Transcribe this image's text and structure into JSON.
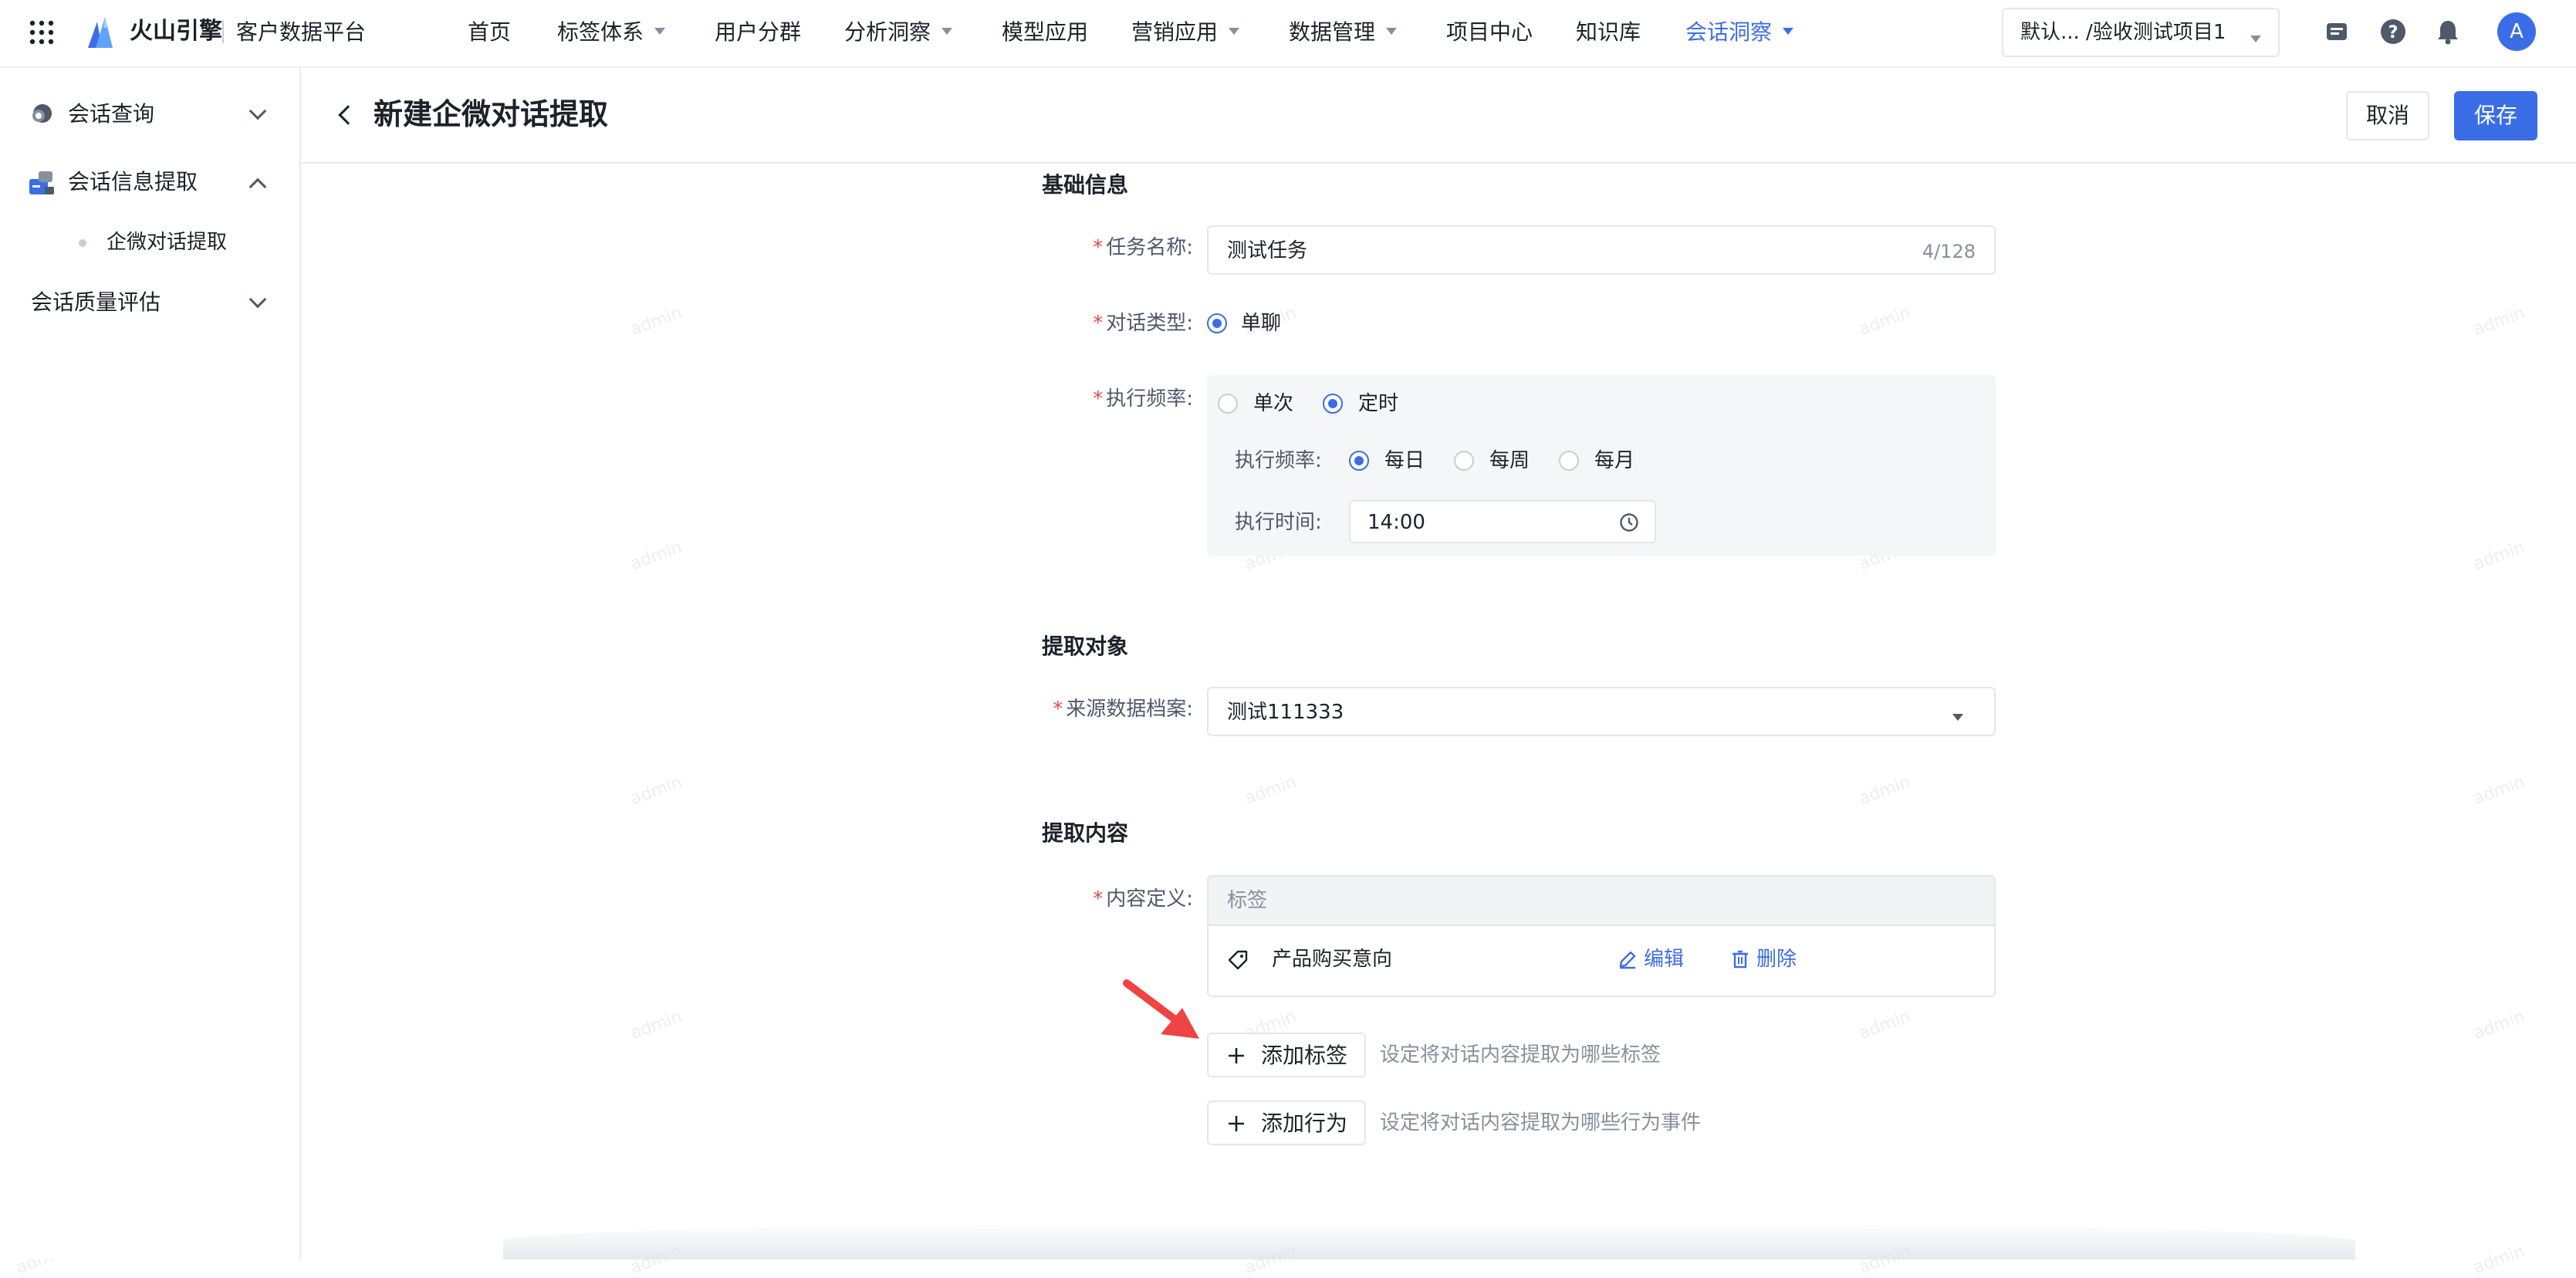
{
  "header": {
    "brand": "火山引擎",
    "product": "客户数据平台",
    "nav": [
      {
        "label": "首页",
        "has_caret": false
      },
      {
        "label": "标签体系",
        "has_caret": true
      },
      {
        "label": "用户分群",
        "has_caret": false
      },
      {
        "label": "分析洞察",
        "has_caret": true
      },
      {
        "label": "模型应用",
        "has_caret": false
      },
      {
        "label": "营销应用",
        "has_caret": true
      },
      {
        "label": "数据管理",
        "has_caret": true
      },
      {
        "label": "项目中心",
        "has_caret": false
      },
      {
        "label": "知识库",
        "has_caret": false
      },
      {
        "label": "会话洞察",
        "has_caret": true,
        "active": true
      }
    ],
    "project_selector": "默认...   /验收测试项目1",
    "avatar_letter": "A",
    "accent_color": "#3b6ee6"
  },
  "sidebar": {
    "items": [
      {
        "label": "会话查询",
        "expanded": false
      },
      {
        "label": "会话信息提取",
        "expanded": true
      },
      {
        "label": "企微对话提取"
      },
      {
        "label": "会话质量评估",
        "expanded": false
      }
    ]
  },
  "page": {
    "title": "新建企微对话提取",
    "cancel_label": "取消",
    "save_label": "保存"
  },
  "form": {
    "basic": {
      "section_title": "基础信息",
      "task_name_label": "任务名称:",
      "task_name_value": "测试任务",
      "task_name_count": "4/128",
      "dialog_type_label": "对话类型:",
      "dialog_type_option": "单聊",
      "frequency_label": "执行频率:",
      "frequency_options": [
        "单次",
        "定时"
      ],
      "frequency_selected": "定时",
      "sub_frequency_label": "执行频率:",
      "sub_frequency_options": [
        "每日",
        "每周",
        "每月"
      ],
      "sub_frequency_selected": "每日",
      "exec_time_label": "执行时间:",
      "exec_time_value": "14:00"
    },
    "target": {
      "section_title": "提取对象",
      "source_label": "来源数据档案:",
      "source_value": "测试111333"
    },
    "content": {
      "section_title": "提取内容",
      "definition_label": "内容定义:",
      "table_header": "标签",
      "row_name": "产品购买意向",
      "edit_label": "编辑",
      "delete_label": "删除",
      "add_tag_label": "添加标签",
      "add_tag_hint": "设定将对话内容提取为哪些标签",
      "add_behavior_label": "添加行为",
      "add_behavior_hint": "设定将对话内容提取为哪些行为事件"
    }
  },
  "watermark": "admin"
}
